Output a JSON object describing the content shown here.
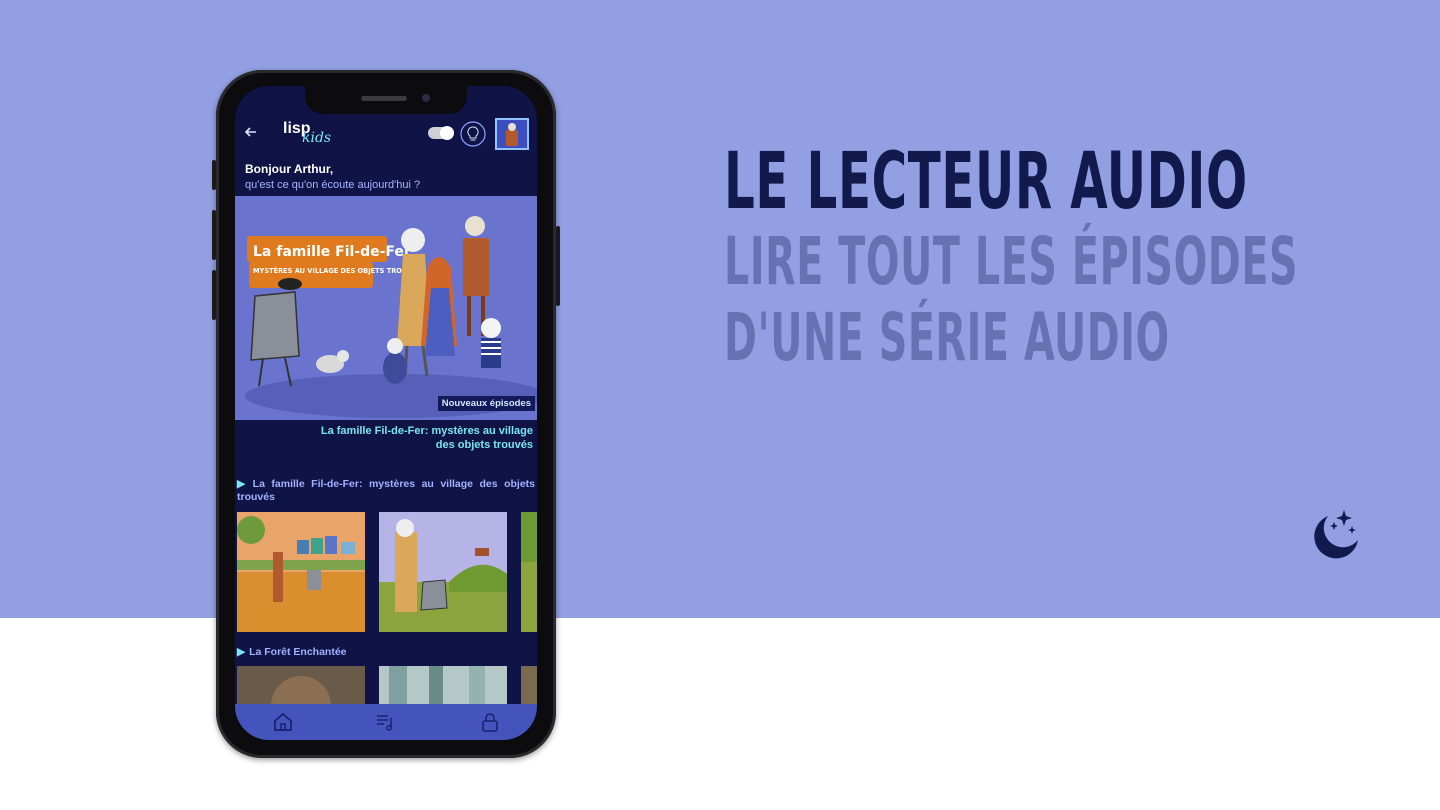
{
  "headline": {
    "title": "LE LECTEUR AUDIO",
    "subtitle_line1": "LIRE TOUT LES ÉPISODES",
    "subtitle_line2": "D'UNE SÉRIE AUDIO"
  },
  "colors": {
    "background_top": "#929fe2",
    "headline_dark": "#121a4d",
    "headline_light": "#6772b3",
    "app_bg": "#0f1346",
    "accent_cyan": "#78e6ee",
    "tabbar": "#4553bc"
  },
  "app": {
    "logo_main": "lisp",
    "logo_sub": "kids",
    "greeting": "Bonjour Arthur,",
    "question": "qu'est ce qu'on écoute aujourd'hui ?",
    "hero": {
      "poster_title": "La famille Fil-de-Fer",
      "poster_subtitle": "MYSTÈRES AU VILLAGE DES OBJETS TROUVÉS",
      "badge": "Nouveaux épisodes",
      "caption": "La famille Fil-de-Fer: mystères au village des objets trouvés"
    },
    "sections": [
      {
        "title": "La famille Fil-de-Fer: mystères au village des objets trouvés"
      },
      {
        "title": "La Forêt Enchantée"
      }
    ],
    "icons": {
      "back": "back-arrow-icon",
      "toggle": "toggle-switch",
      "bulb": "lightbulb-icon",
      "home": "home-icon",
      "playlist": "playlist-icon",
      "lock": "lock-icon",
      "brand": "moon-stars-icon"
    }
  }
}
